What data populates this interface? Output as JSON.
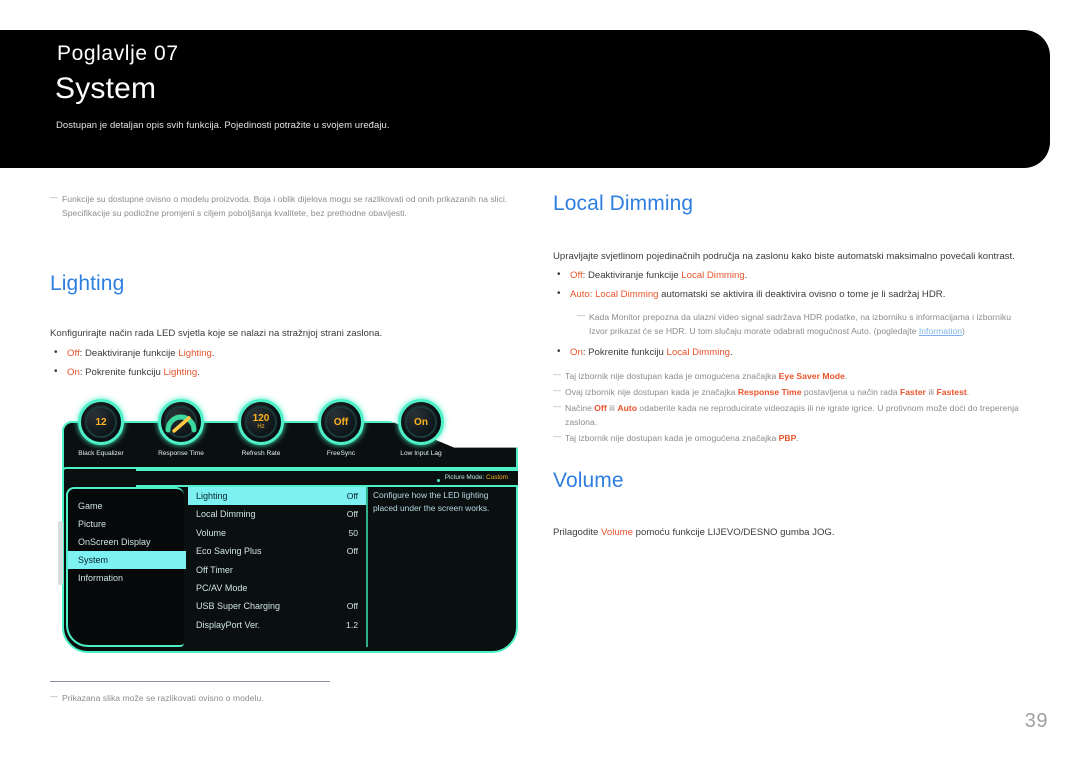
{
  "header": {
    "chapter": "Poglavlje  07",
    "title": "System",
    "subtitle": "Dostupan je detaljan opis svih funkcija. Pojedinosti potražite u svojem uređaju."
  },
  "left": {
    "intro_note": "Funkcije su dostupne ovisno o modelu proizvoda. Boja i oblik dijelova mogu se razlikovati od onih prikazanih na slici. Specifikacije su podložne promjeni s ciljem poboljšanja kvalitete, bez prethodne obavijesti.",
    "lighting": {
      "heading": "Lighting",
      "body": "Konfigurirajte način rada LED svjetla koje se nalazi na stražnjoj strani zaslona.",
      "bullets": [
        {
          "key": "Off",
          "mid": ": Deaktiviranje funkcije ",
          "term": "Lighting",
          "end": "."
        },
        {
          "key": "On",
          "mid": ": Pokrenite funkciju ",
          "term": "Lighting",
          "end": "."
        }
      ]
    },
    "footnote": "Prikazana slika može se razlikovati ovisno o modelu."
  },
  "osd": {
    "dials": [
      {
        "label": "Black Equalizer",
        "value": "12",
        "unit": "",
        "icon": "dial-value"
      },
      {
        "label": "Response Time",
        "value": "",
        "unit": "",
        "icon": "gauge-needle-icon"
      },
      {
        "label": "Refresh Rate",
        "value": "120",
        "unit": "Hz",
        "icon": "dial-value"
      },
      {
        "label": "FreeSync",
        "value": "Off",
        "unit": "",
        "icon": "dial-value"
      },
      {
        "label": "Low Input Lag",
        "value": "On",
        "unit": "",
        "icon": "dial-value"
      }
    ],
    "picture_mode_label": "Picture Mode:",
    "picture_mode_value": "Custom",
    "categories": [
      {
        "label": "Game",
        "active": false
      },
      {
        "label": "Picture",
        "active": false
      },
      {
        "label": "OnScreen Display",
        "active": false
      },
      {
        "label": "System",
        "active": true
      },
      {
        "label": "Information",
        "active": false
      }
    ],
    "items": [
      {
        "label": "Lighting",
        "value": "Off",
        "active": true
      },
      {
        "label": "Local Dimming",
        "value": "Off",
        "active": false
      },
      {
        "label": "Volume",
        "value": "50",
        "active": false
      },
      {
        "label": "Eco Saving Plus",
        "value": "Off",
        "active": false
      },
      {
        "label": "Off Timer",
        "value": "",
        "active": false
      },
      {
        "label": "PC/AV Mode",
        "value": "",
        "active": false
      },
      {
        "label": "USB Super Charging",
        "value": "Off",
        "active": false
      },
      {
        "label": "DisplayPort Ver.",
        "value": "1.2",
        "active": false
      }
    ],
    "description": "Configure how the LED lighting placed under the screen works."
  },
  "right": {
    "local_dimming": {
      "heading": "Local Dimming",
      "body": "Upravljajte svjetlinom pojedinačnih područja na zaslonu kako biste automatski maksimalno povećali kontrast.",
      "bullet1_key": "Off",
      "bullet1_mid": ": Deaktiviranje funkcije ",
      "bullet1_term": "Local Dimming",
      "bullet1_end": ".",
      "bullet2_key": "Auto: Local Dimming",
      "bullet2_rest": " automatski se aktivira ili deaktivira ovisno o tome je li sadržaj HDR.",
      "subnote_a": "Kada Monitor prepozna da ulazni video signal sadržava HDR podatke, na izborniku s informacijama i izborniku Izvor prikazat će se HDR. U tom slučaju morate odabrati mogućnost Auto. (pogledajte ",
      "subnote_link": "Information",
      "subnote_b": ")",
      "bullet3_key": "On",
      "bullet3_mid": ": Pokrenite funkciju ",
      "bullet3_term": "Local Dimming",
      "bullet3_end": ".",
      "note1_a": "Taj izbornik nije dostupan kada je omogućena značajka ",
      "note1_b": "Eye Saver Mode",
      "note1_c": ".",
      "note2_a": "Ovaj izbornik nije dostupan kada je značajka ",
      "note2_b": "Response Time",
      "note2_c": " postavljena u način rada ",
      "note2_d": "Faster",
      "note2_e": " ili ",
      "note2_f": "Fastest",
      "note2_g": ".",
      "note3_a": "Načine ",
      "note3_b": "Off",
      "note3_c": " ili ",
      "note3_d": "Auto",
      "note3_e": " odaberite kada ne reproducirate videozapis ili ne igrate igrice. U protivnom može doći do treperenja zaslona.",
      "note4_a": "Taj izbornik nije dostupan kada je omogućena značajka ",
      "note4_b": "PBP",
      "note4_c": "."
    },
    "volume": {
      "heading": "Volume",
      "body_a": "Prilagodite ",
      "body_term": "Volume",
      "body_b": " pomoću funkcije LIJEVO/DESNO gumba JOG."
    }
  },
  "page_number": "39",
  "colors": {
    "accent_blue": "#2f7fe0",
    "accent_red": "#e8532a",
    "osd_cyan": "#4ef0c8",
    "osd_highlight": "#7df0f2",
    "osd_amber": "#ffb220",
    "banner_bg": "#000000"
  }
}
